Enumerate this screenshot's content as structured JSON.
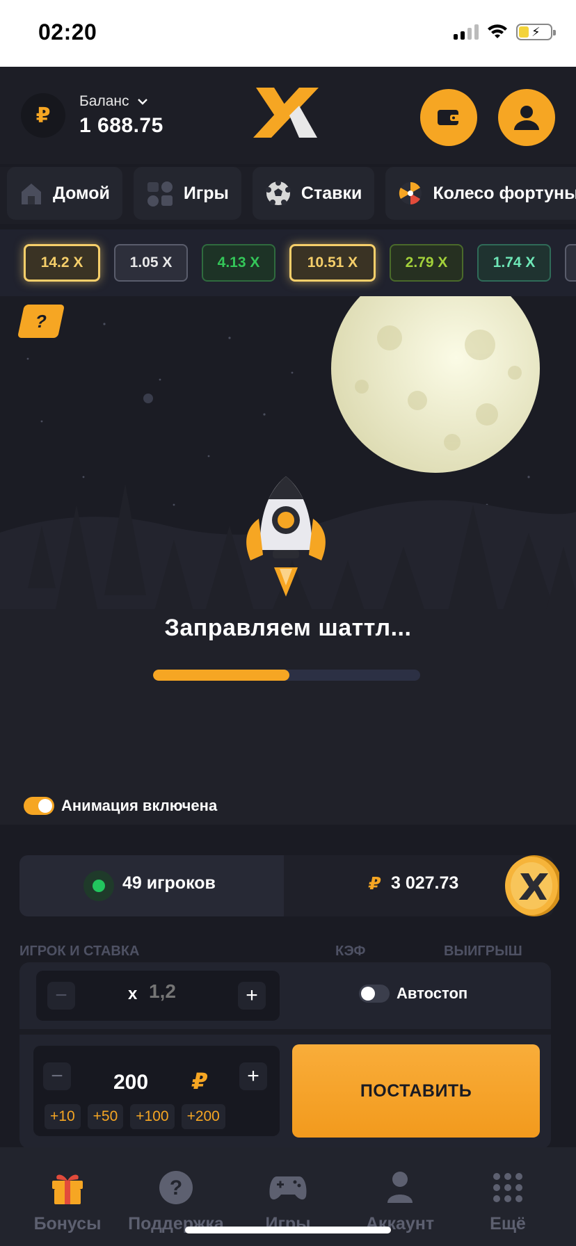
{
  "status_bar": {
    "time": "02:20"
  },
  "header": {
    "balance_label": "Баланс",
    "balance_value": "1 688.75",
    "currency_symbol": "₽"
  },
  "nav_tabs": [
    {
      "label": "Домой",
      "icon": "home-icon"
    },
    {
      "label": "Игры",
      "icon": "games-grid-icon"
    },
    {
      "label": "Ставки",
      "icon": "soccer-ball-icon"
    },
    {
      "label": "Колесо фортуны",
      "icon": "fortune-wheel-icon"
    }
  ],
  "multipliers": [
    {
      "label": "14.2 X",
      "style": "gold"
    },
    {
      "label": "1.05 X",
      "style": "gray"
    },
    {
      "label": "4.13 X",
      "style": "green"
    },
    {
      "label": "10.51 X",
      "style": "gold"
    },
    {
      "label": "2.79 X",
      "style": "olive"
    },
    {
      "label": "1.74 X",
      "style": "teal"
    }
  ],
  "game": {
    "help_label": "?",
    "status_text": "Заправляем шаттл...",
    "progress_fraction": 0.51,
    "animation_label": "Анимация включена",
    "animation_on": true
  },
  "players": {
    "count_label": "49 игроков",
    "pot_currency": "₽",
    "pot_value": "3 027.73"
  },
  "columns": {
    "player": "ИГРОК И СТАВКА",
    "coef": "КЭФ",
    "win": "ВЫИГРЫШ"
  },
  "bet": {
    "coef_prefix": "x",
    "coef_placeholder": "1,2",
    "autostop_label": "Автостоп",
    "amount": "200",
    "amount_currency": "₽",
    "quick_amounts": [
      "+10",
      "+50",
      "+100",
      "+200"
    ],
    "place_label": "ПОСТАВИТЬ",
    "minus": "−",
    "plus": "+"
  },
  "bottom_nav": [
    {
      "label": "Бонусы",
      "icon": "gift-icon",
      "active": true
    },
    {
      "label": "Поддержка",
      "icon": "help-icon",
      "active": false
    },
    {
      "label": "Игры",
      "icon": "gamepad-icon",
      "active": false
    },
    {
      "label": "Аккаунт",
      "icon": "person-icon",
      "active": false
    },
    {
      "label": "Ещё",
      "icon": "dots-grid-icon",
      "active": false
    }
  ],
  "colors": {
    "accent": "#f6a623",
    "background": "#1a1b23",
    "green": "#22c55e"
  }
}
